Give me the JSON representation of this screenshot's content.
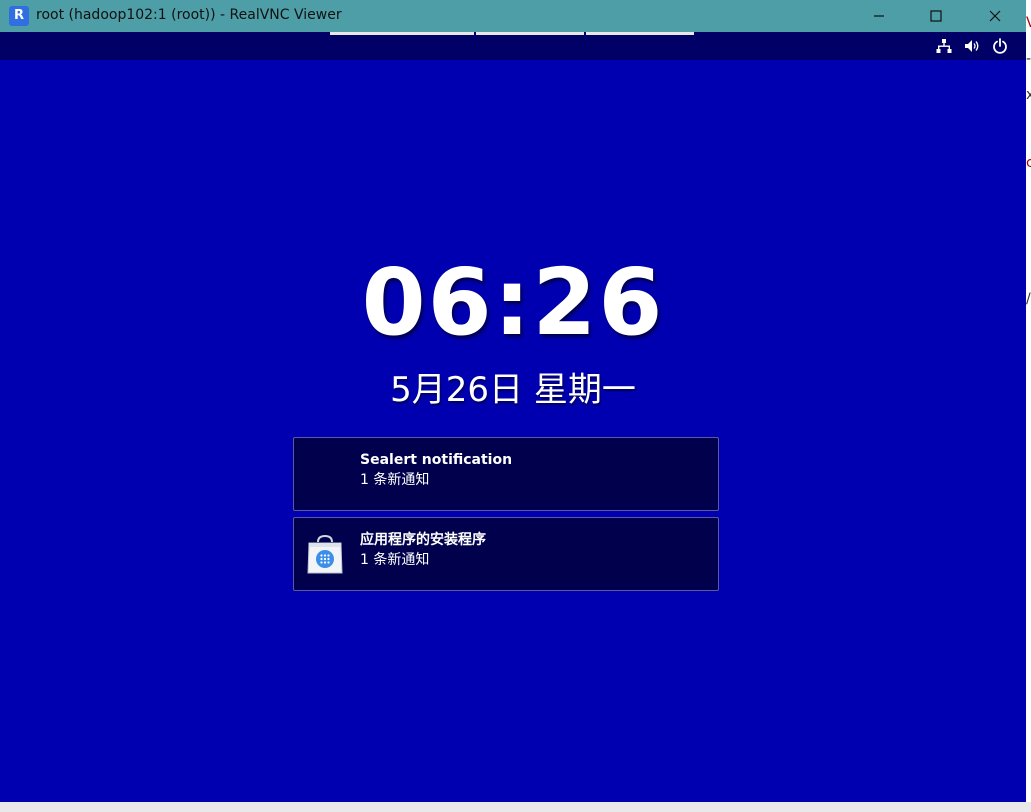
{
  "window": {
    "title": "root (hadoop102:1 (root)) - RealVNC Viewer",
    "app_icon": "realvnc-logo-icon",
    "controls": [
      "minimize-icon",
      "maximize-icon",
      "close-icon"
    ]
  },
  "topbar": {
    "tray_icons": [
      "network-icon",
      "volume-icon",
      "power-icon"
    ]
  },
  "lockscreen": {
    "time": "06:26",
    "date": "5月26日 星期一"
  },
  "notifications": [
    {
      "title": "Sealert notification",
      "subtitle": "1 条新通知",
      "icon": "none"
    },
    {
      "title": "应用程序的安装程序",
      "subtitle": "1 条新通知",
      "icon": "software-installer-icon"
    }
  ],
  "background_fragments": [
    "V",
    "-",
    "x",
    "c",
    "/"
  ],
  "colors": {
    "titlebar": "#4d9ea6",
    "desktop": "#0000b0",
    "topbar": "#000066",
    "notification_bg": "#00004d"
  }
}
